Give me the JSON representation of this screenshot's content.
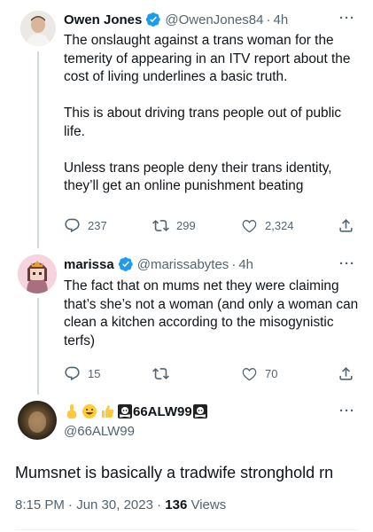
{
  "tweets": [
    {
      "name": "Owen Jones",
      "handle": "@OwenJones84",
      "time": "4h",
      "paragraphs": [
        "The onslaught against a trans woman for the temerity of appearing in an ITV report about the cost of living underlines a basic truth.",
        "This is about driving trans people out of public life.",
        "Unless trans people deny their trans identity, they’ll get an online punishment beating"
      ],
      "replies": "237",
      "retweets": "299",
      "likes": "2,324"
    },
    {
      "name": "marissa",
      "handle": "@marissabytes",
      "time": "4h",
      "paragraphs": [
        "The fact that on mums net they were claiming that’s she’s not a woman (and only a woman can clean a kitchen according to the misogynistic terfs)"
      ],
      "replies": "15",
      "retweets": "",
      "likes": "70"
    }
  ],
  "main_tweet": {
    "name": "66ALW99",
    "handle": "@66ALW99",
    "text": "Mumsnet is basically a tradwife stronghold rn",
    "time": "8:15 PM · Jun 30, 2023 · ",
    "views_count": "136",
    "views_label": " Views"
  },
  "separator": "·",
  "more": "···",
  "colors": {
    "verified": "#1d9bf0",
    "secondary_text": "#536471",
    "thread_line": "#cfd9de"
  },
  "icons": [
    "verified-badge-icon",
    "reply-icon",
    "retweet-icon",
    "like-icon",
    "share-icon",
    "more-icon"
  ]
}
